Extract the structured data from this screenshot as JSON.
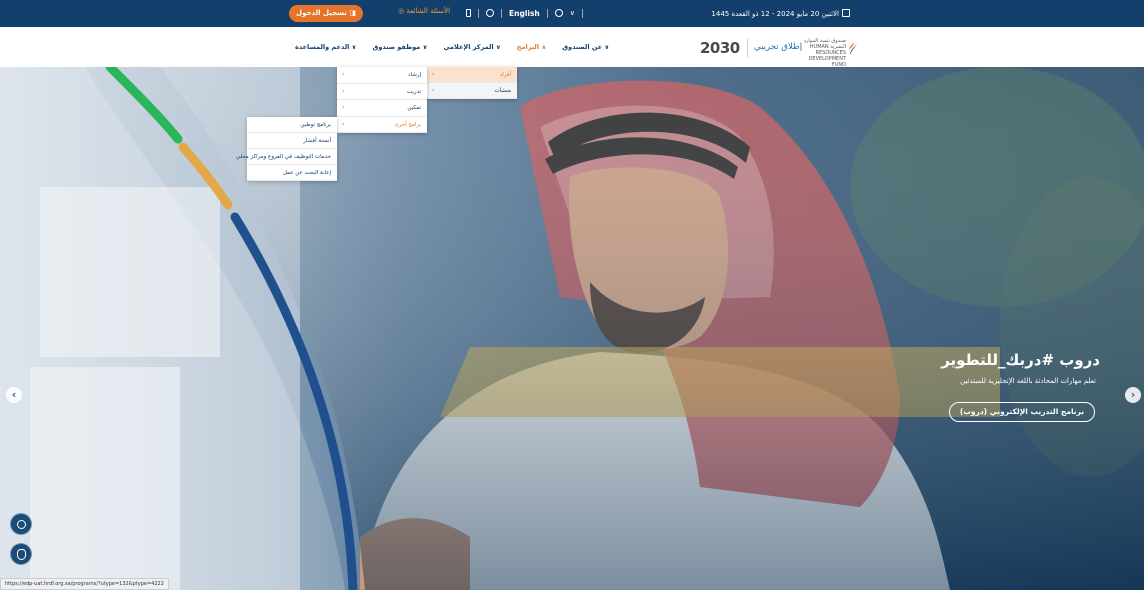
{
  "topbar": {
    "date": "الاثنين 20 مايو 2024 - 12 ذو القعدة 1445",
    "language": "English",
    "faq": "الأسئلة الشائعة",
    "register": "تسجيل الدخول"
  },
  "logo": {
    "vision": "2030",
    "trial": "إطلاق تجريبي",
    "hrdf": "صندوق تنمية الموارد البشرية HUMAN RESOURCES DEVELOPMENT FUND"
  },
  "nav": {
    "items": [
      {
        "label": "عن الصندوق",
        "active": false
      },
      {
        "label": "البرامج",
        "active": true
      },
      {
        "label": "المركز الإعلامي",
        "active": false
      },
      {
        "label": "موظفو صندوق",
        "active": false
      },
      {
        "label": "الدعم والمساعدة",
        "active": false
      }
    ]
  },
  "dropdown1": {
    "items": [
      "أفراد",
      "منشآت"
    ]
  },
  "dropdown2": {
    "items": [
      "إرشاد",
      "تدريب",
      "تمكين",
      "برامج أخرى"
    ]
  },
  "dropdown3": {
    "items": [
      "برنامج توطين",
      "أنسنة أفشار",
      "خدمات التوظيف في الفروع ومراكز محلي",
      "إعانة البحث عن عمل"
    ]
  },
  "hero": {
    "title": "دروب #دربك_للتطوير",
    "subtitle": "تعلم مهارات المحادثة باللغة الإنجليزية للمبتدئين",
    "button": "برنامج التدريب الإلكتروني (دروب)"
  },
  "status_url": "https://edp-uat.hrdf.org.sa/programs/?utype=132&ptype=4222",
  "colors": {
    "header_bg": "#123f6b",
    "accent_orange": "#e5742b",
    "stripe_green": "#2bb55a",
    "stripe_gold": "#e3a849",
    "stripe_navy": "#1f4f8c"
  }
}
